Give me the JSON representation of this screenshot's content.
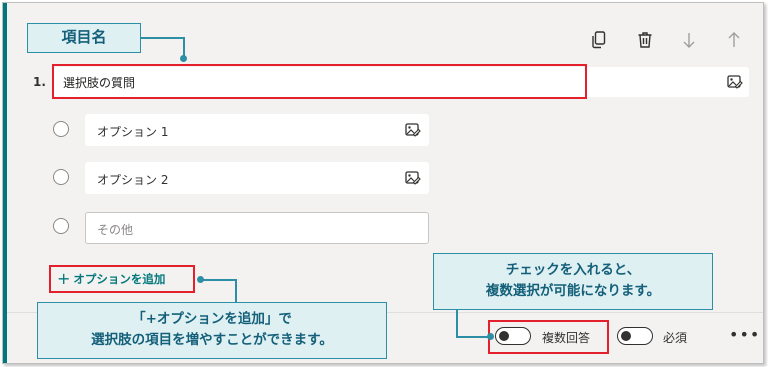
{
  "toolbar": {
    "copy_icon": "copy-icon",
    "delete_icon": "trash-icon",
    "down_icon": "arrow-down-icon",
    "up_icon": "arrow-up-icon"
  },
  "question": {
    "number": "1.",
    "text": "選択肢の質問",
    "media_icon": "insert-image-icon"
  },
  "options": [
    {
      "label": "オプション 1"
    },
    {
      "label": "オプション 2"
    }
  ],
  "other_option": {
    "label": "その他"
  },
  "add_option": {
    "plus": "+",
    "label": "オプションを追加"
  },
  "footer": {
    "multiple_answers_label": "複数回答",
    "required_label": "必須",
    "more_icon": "•••"
  },
  "annotations": {
    "item_name": "項目名",
    "add_option_note_line1": "「+オプションを追加」で",
    "add_option_note_line2": "選択肢の項目を増やすことができます。",
    "multi_note_line1": "チェックを入れると、",
    "multi_note_line2": "複数選択が可能になります。"
  },
  "colors": {
    "accent": "#03787c",
    "highlight_red": "#e3202b",
    "callout_fill": "#dff0f3",
    "callout_border": "#2d8fa5"
  }
}
